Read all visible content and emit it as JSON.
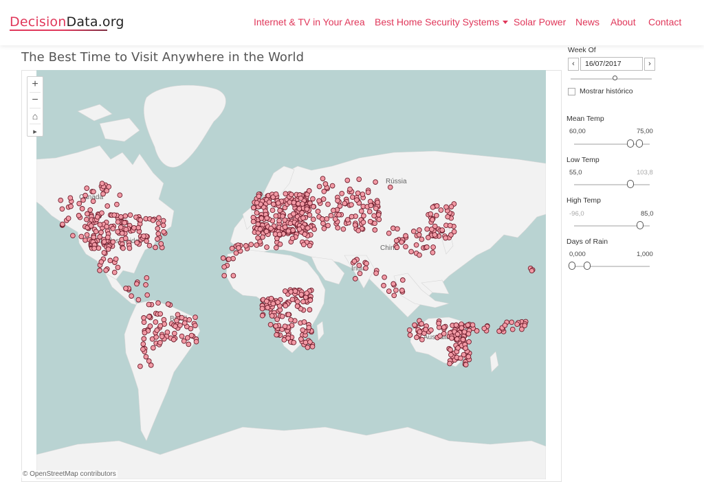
{
  "header": {
    "logo_part1": "Decision",
    "logo_part2": "Data.org",
    "nav": [
      {
        "label": "Internet & TV in Your Area"
      },
      {
        "label": "Best Home Security Systems"
      },
      {
        "label": "Solar Power"
      },
      {
        "label": "News"
      },
      {
        "label": "About"
      },
      {
        "label": "Contact"
      }
    ]
  },
  "page": {
    "title": "The Best Time to Visit Anywhere in the World"
  },
  "map": {
    "tools": [
      "+",
      "−",
      "⌂",
      "▸"
    ],
    "attribution": "© OpenStreetMap contributors",
    "labels": [
      "Canadá",
      "Estados Unidos",
      "Rússia",
      "China",
      "Índia",
      "Brasil",
      "Austrália"
    ],
    "colors": {
      "water": "#b9d3d2",
      "land": "#f2f2f2",
      "marker_fill": "#f29aa5",
      "marker_stroke": "#6d1c2b"
    }
  },
  "filters": {
    "week_of": {
      "label": "Week Of",
      "value": "16/07/2017",
      "prev": "‹",
      "next": "›"
    },
    "show_history": {
      "label": "Mostrar histórico",
      "checked": false
    },
    "mean_temp": {
      "label": "Mean Temp",
      "min": "60,00",
      "max": "75,00"
    },
    "low_temp": {
      "label": "Low Temp",
      "min": "55,0",
      "max": "103,8"
    },
    "high_temp": {
      "label": "High Temp",
      "min": "-96,0",
      "max": "85,0"
    },
    "days_of_rain": {
      "label": "Days of Rain",
      "min": "0,000",
      "max": "1,000"
    }
  }
}
